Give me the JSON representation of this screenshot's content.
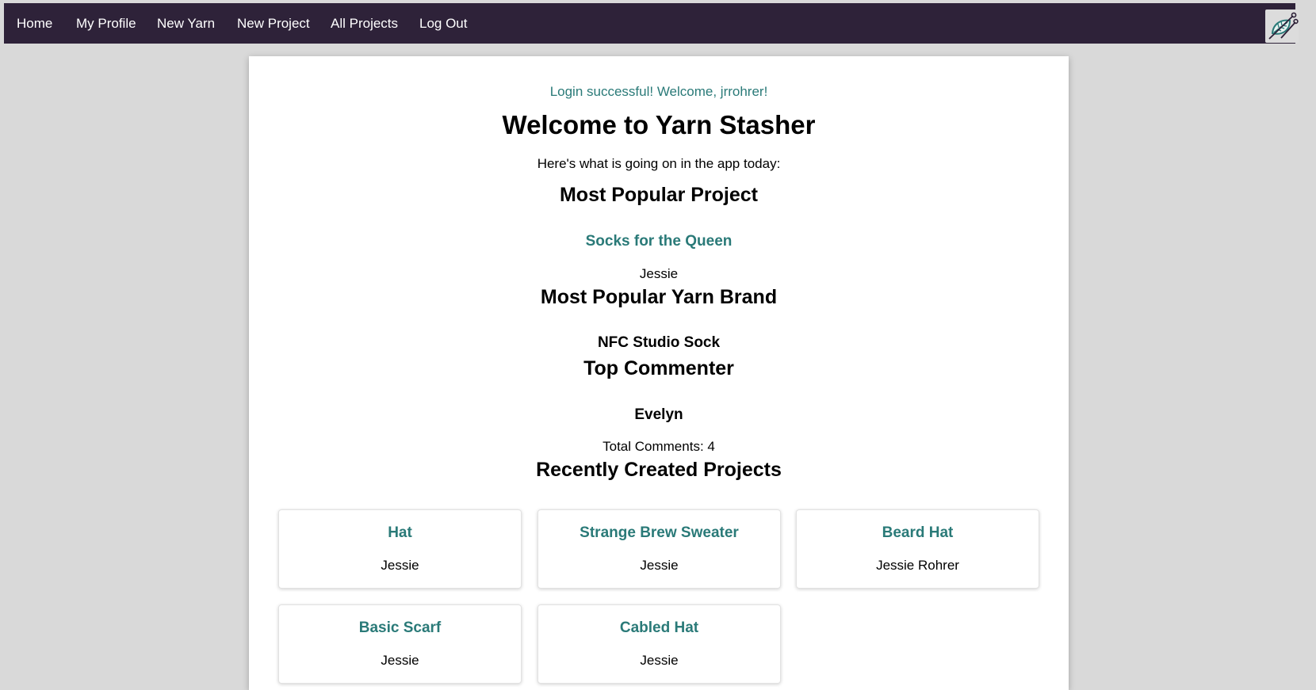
{
  "nav": {
    "items": [
      "Home",
      "My Profile",
      "New Yarn",
      "New Project",
      "All Projects",
      "Log Out"
    ],
    "logo_icon": "yarn-leaf-needles-logo"
  },
  "colors": {
    "nav_bg": "#2e2239",
    "accent": "#2a7a78",
    "page_bg": "#d9d9d9"
  },
  "main": {
    "flash": "Login successful! Welcome, jrrohrer!",
    "title": "Welcome to Yarn Stasher",
    "intro": "Here's what is going on in the app today:",
    "popular_project": {
      "heading": "Most Popular Project",
      "name": "Socks for the Queen",
      "owner": "Jessie"
    },
    "popular_brand": {
      "heading": "Most Popular Yarn Brand",
      "name": "NFC Studio Sock"
    },
    "top_commenter": {
      "heading": "Top Commenter",
      "name": "Evelyn",
      "total": "Total Comments: 4"
    },
    "recent": {
      "heading": "Recently Created Projects",
      "projects": [
        {
          "title": "Hat",
          "owner": "Jessie"
        },
        {
          "title": "Strange Brew Sweater",
          "owner": "Jessie"
        },
        {
          "title": "Beard Hat",
          "owner": "Jessie Rohrer"
        },
        {
          "title": "Basic Scarf",
          "owner": "Jessie"
        },
        {
          "title": "Cabled Hat",
          "owner": "Jessie"
        }
      ]
    }
  }
}
